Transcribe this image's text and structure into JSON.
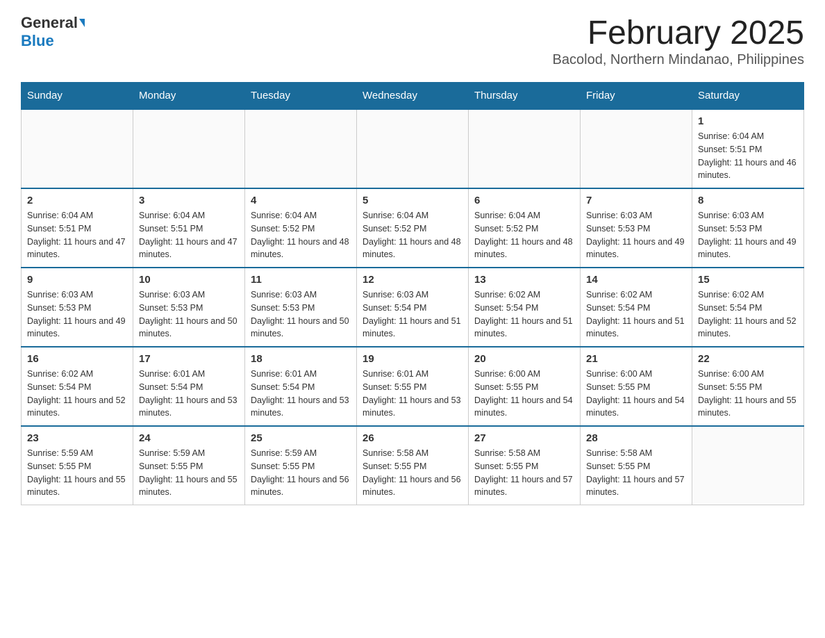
{
  "logo": {
    "general": "General",
    "blue": "Blue"
  },
  "title": "February 2025",
  "subtitle": "Bacolod, Northern Mindanao, Philippines",
  "days_header": [
    "Sunday",
    "Monday",
    "Tuesday",
    "Wednesday",
    "Thursday",
    "Friday",
    "Saturday"
  ],
  "weeks": [
    [
      {
        "num": "",
        "info": ""
      },
      {
        "num": "",
        "info": ""
      },
      {
        "num": "",
        "info": ""
      },
      {
        "num": "",
        "info": ""
      },
      {
        "num": "",
        "info": ""
      },
      {
        "num": "",
        "info": ""
      },
      {
        "num": "1",
        "info": "Sunrise: 6:04 AM\nSunset: 5:51 PM\nDaylight: 11 hours and 46 minutes."
      }
    ],
    [
      {
        "num": "2",
        "info": "Sunrise: 6:04 AM\nSunset: 5:51 PM\nDaylight: 11 hours and 47 minutes."
      },
      {
        "num": "3",
        "info": "Sunrise: 6:04 AM\nSunset: 5:51 PM\nDaylight: 11 hours and 47 minutes."
      },
      {
        "num": "4",
        "info": "Sunrise: 6:04 AM\nSunset: 5:52 PM\nDaylight: 11 hours and 48 minutes."
      },
      {
        "num": "5",
        "info": "Sunrise: 6:04 AM\nSunset: 5:52 PM\nDaylight: 11 hours and 48 minutes."
      },
      {
        "num": "6",
        "info": "Sunrise: 6:04 AM\nSunset: 5:52 PM\nDaylight: 11 hours and 48 minutes."
      },
      {
        "num": "7",
        "info": "Sunrise: 6:03 AM\nSunset: 5:53 PM\nDaylight: 11 hours and 49 minutes."
      },
      {
        "num": "8",
        "info": "Sunrise: 6:03 AM\nSunset: 5:53 PM\nDaylight: 11 hours and 49 minutes."
      }
    ],
    [
      {
        "num": "9",
        "info": "Sunrise: 6:03 AM\nSunset: 5:53 PM\nDaylight: 11 hours and 49 minutes."
      },
      {
        "num": "10",
        "info": "Sunrise: 6:03 AM\nSunset: 5:53 PM\nDaylight: 11 hours and 50 minutes."
      },
      {
        "num": "11",
        "info": "Sunrise: 6:03 AM\nSunset: 5:53 PM\nDaylight: 11 hours and 50 minutes."
      },
      {
        "num": "12",
        "info": "Sunrise: 6:03 AM\nSunset: 5:54 PM\nDaylight: 11 hours and 51 minutes."
      },
      {
        "num": "13",
        "info": "Sunrise: 6:02 AM\nSunset: 5:54 PM\nDaylight: 11 hours and 51 minutes."
      },
      {
        "num": "14",
        "info": "Sunrise: 6:02 AM\nSunset: 5:54 PM\nDaylight: 11 hours and 51 minutes."
      },
      {
        "num": "15",
        "info": "Sunrise: 6:02 AM\nSunset: 5:54 PM\nDaylight: 11 hours and 52 minutes."
      }
    ],
    [
      {
        "num": "16",
        "info": "Sunrise: 6:02 AM\nSunset: 5:54 PM\nDaylight: 11 hours and 52 minutes."
      },
      {
        "num": "17",
        "info": "Sunrise: 6:01 AM\nSunset: 5:54 PM\nDaylight: 11 hours and 53 minutes."
      },
      {
        "num": "18",
        "info": "Sunrise: 6:01 AM\nSunset: 5:54 PM\nDaylight: 11 hours and 53 minutes."
      },
      {
        "num": "19",
        "info": "Sunrise: 6:01 AM\nSunset: 5:55 PM\nDaylight: 11 hours and 53 minutes."
      },
      {
        "num": "20",
        "info": "Sunrise: 6:00 AM\nSunset: 5:55 PM\nDaylight: 11 hours and 54 minutes."
      },
      {
        "num": "21",
        "info": "Sunrise: 6:00 AM\nSunset: 5:55 PM\nDaylight: 11 hours and 54 minutes."
      },
      {
        "num": "22",
        "info": "Sunrise: 6:00 AM\nSunset: 5:55 PM\nDaylight: 11 hours and 55 minutes."
      }
    ],
    [
      {
        "num": "23",
        "info": "Sunrise: 5:59 AM\nSunset: 5:55 PM\nDaylight: 11 hours and 55 minutes."
      },
      {
        "num": "24",
        "info": "Sunrise: 5:59 AM\nSunset: 5:55 PM\nDaylight: 11 hours and 55 minutes."
      },
      {
        "num": "25",
        "info": "Sunrise: 5:59 AM\nSunset: 5:55 PM\nDaylight: 11 hours and 56 minutes."
      },
      {
        "num": "26",
        "info": "Sunrise: 5:58 AM\nSunset: 5:55 PM\nDaylight: 11 hours and 56 minutes."
      },
      {
        "num": "27",
        "info": "Sunrise: 5:58 AM\nSunset: 5:55 PM\nDaylight: 11 hours and 57 minutes."
      },
      {
        "num": "28",
        "info": "Sunrise: 5:58 AM\nSunset: 5:55 PM\nDaylight: 11 hours and 57 minutes."
      },
      {
        "num": "",
        "info": ""
      }
    ]
  ]
}
